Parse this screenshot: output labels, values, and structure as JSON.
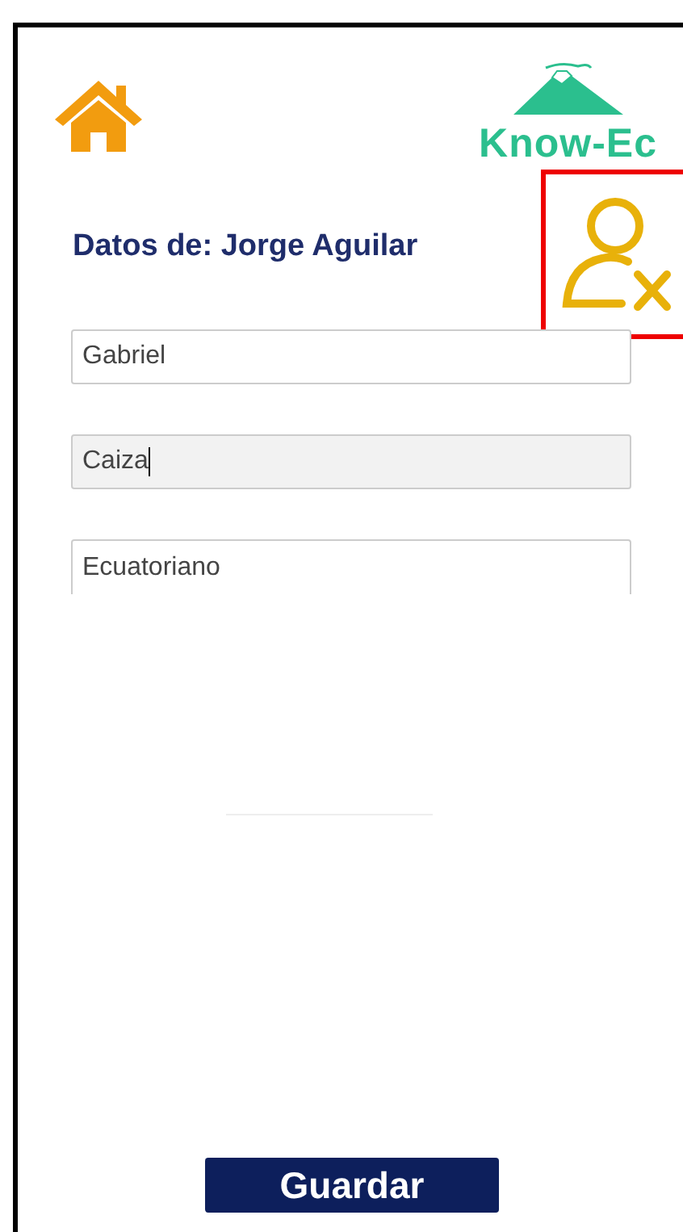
{
  "logo": {
    "text": "Know-Ec"
  },
  "heading": "Datos de: Jorge Aguilar",
  "fields": [
    {
      "value": "Gabriel",
      "focused": false
    },
    {
      "value": "Caiza",
      "focused": true
    },
    {
      "value": "Ecuatoriano",
      "focused": false
    }
  ],
  "buttons": [
    "Guardar"
  ]
}
